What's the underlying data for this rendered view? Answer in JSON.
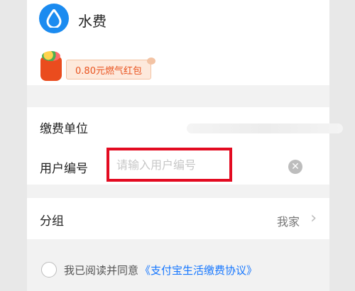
{
  "header": {
    "icon": "water-drop-icon",
    "title": "水费",
    "coupon_label": "0.80元燃气红包"
  },
  "form": {
    "unit_label": "缴费单位",
    "user_label": "用户编号",
    "user_placeholder": "请输入用户编号"
  },
  "group": {
    "label": "分组",
    "value": "我家",
    "chevron": "›"
  },
  "agreement": {
    "prefix": "我已阅读并同意",
    "link": "《支付宝生活缴费协议》"
  },
  "colors": {
    "accent": "#1b8bf0",
    "highlight_border": "#e30b21",
    "coupon_text": "#e9531f",
    "link": "#1677ff"
  }
}
